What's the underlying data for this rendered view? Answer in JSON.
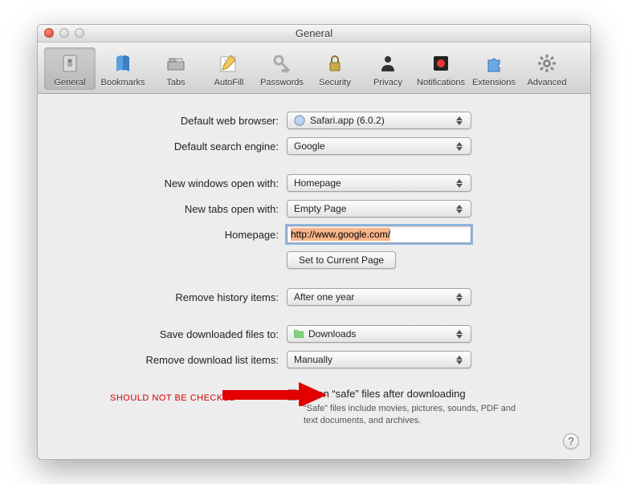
{
  "window": {
    "title": "General"
  },
  "toolbar": {
    "items": [
      {
        "label": "General",
        "icon": "switch-icon",
        "active": true
      },
      {
        "label": "Bookmarks",
        "icon": "book-icon",
        "active": false
      },
      {
        "label": "Tabs",
        "icon": "tabs-icon",
        "active": false
      },
      {
        "label": "AutoFill",
        "icon": "pencil-icon",
        "active": false
      },
      {
        "label": "Passwords",
        "icon": "key-icon",
        "active": false
      },
      {
        "label": "Security",
        "icon": "lock-icon",
        "active": false
      },
      {
        "label": "Privacy",
        "icon": "person-icon",
        "active": false
      },
      {
        "label": "Notifications",
        "icon": "record-icon",
        "active": false
      },
      {
        "label": "Extensions",
        "icon": "puzzle-icon",
        "active": false
      },
      {
        "label": "Advanced",
        "icon": "gear-icon",
        "active": false
      }
    ]
  },
  "labels": {
    "default_browser": "Default web browser:",
    "default_search": "Default search engine:",
    "new_windows": "New windows open with:",
    "new_tabs": "New tabs open with:",
    "homepage": "Homepage:",
    "set_current": "Set to Current Page",
    "remove_history": "Remove history items:",
    "save_downloads": "Save downloaded files to:",
    "remove_downloads": "Remove download list items:"
  },
  "values": {
    "default_browser": "Safari.app (6.0.2)",
    "default_search": "Google",
    "new_windows": "Homepage",
    "new_tabs": "Empty Page",
    "homepage": "http://www.google.com/",
    "remove_history": "After one year",
    "save_downloads": "Downloads",
    "remove_downloads": "Manually"
  },
  "safe": {
    "checked": false,
    "label": "Open “safe” files after downloading",
    "desc": "“Safe” files include movies, pictures, sounds, PDF and text documents, and archives."
  },
  "annotation": "SHOULD NOT BE CHECKED",
  "help": "?"
}
